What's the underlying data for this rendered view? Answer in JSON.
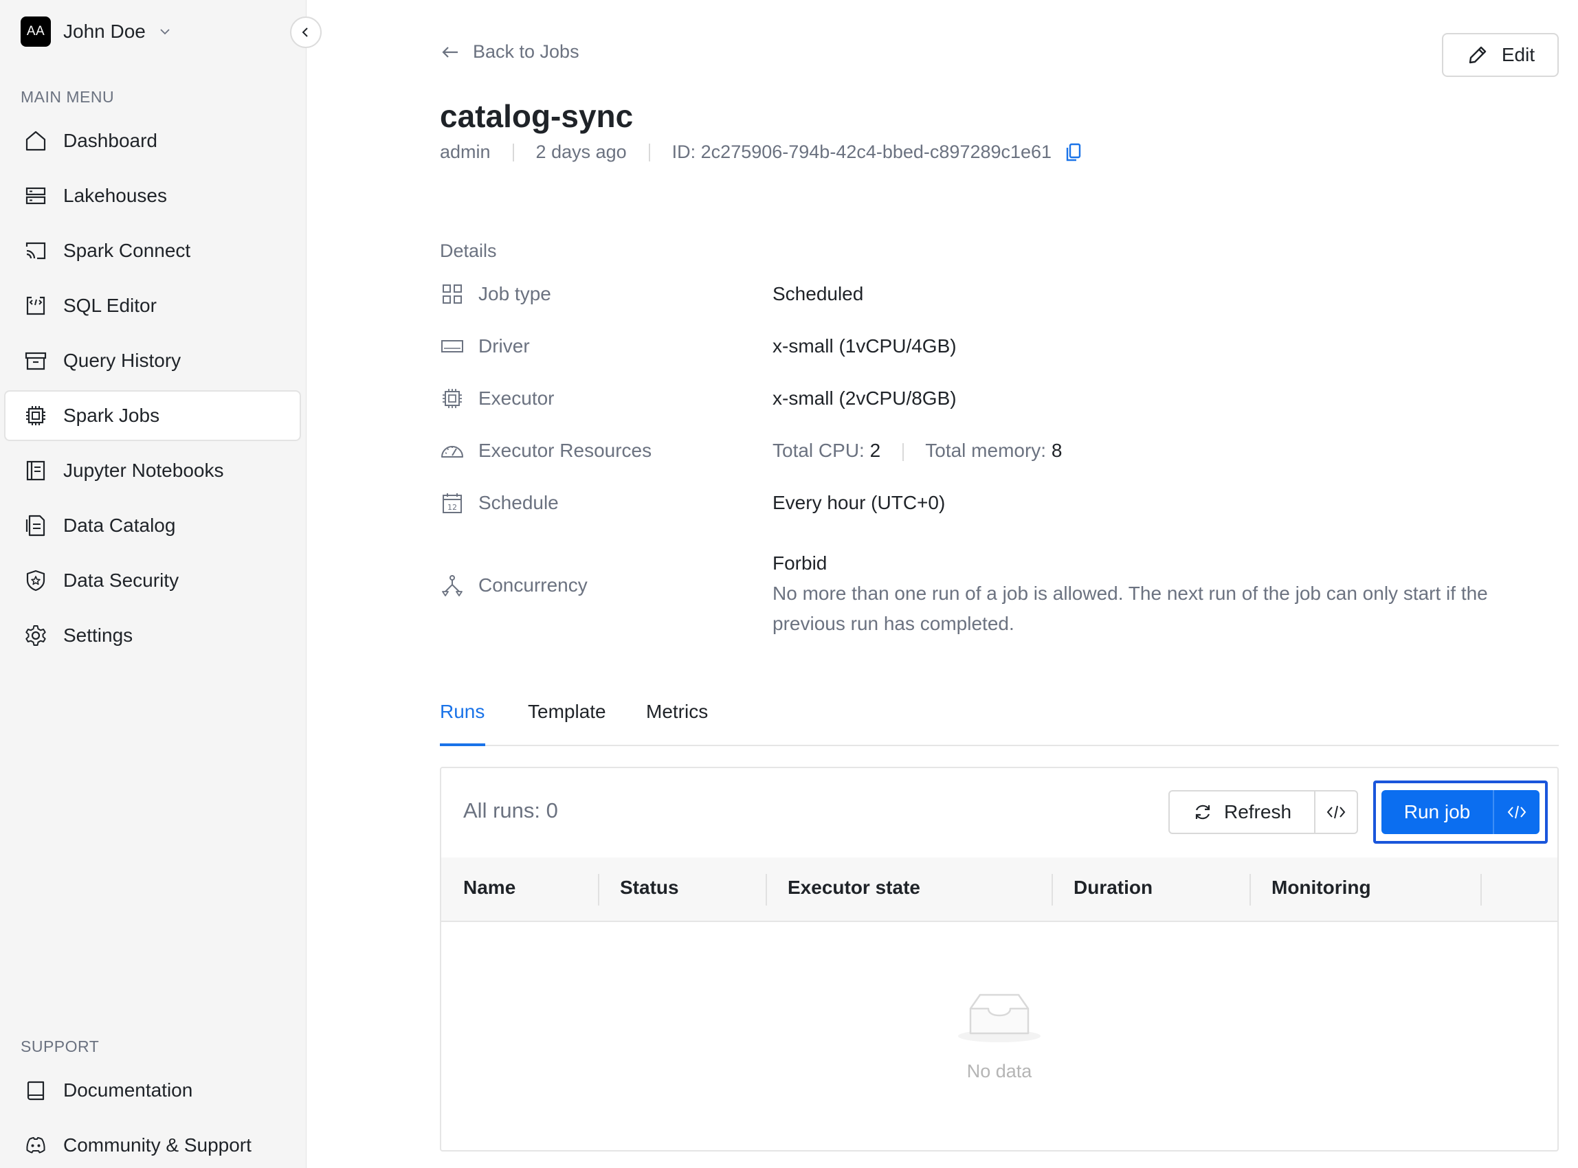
{
  "user": {
    "initials": "AA",
    "name": "John Doe"
  },
  "sidebar": {
    "main_menu_label": "MAIN MENU",
    "items": [
      {
        "label": "Dashboard",
        "icon": "home-icon"
      },
      {
        "label": "Lakehouses",
        "icon": "server-icon"
      },
      {
        "label": "Spark Connect",
        "icon": "cast-icon"
      },
      {
        "label": "SQL Editor",
        "icon": "sql-editor-icon"
      },
      {
        "label": "Query History",
        "icon": "archive-icon"
      },
      {
        "label": "Spark Jobs",
        "icon": "cpu-icon",
        "active": true
      },
      {
        "label": "Jupyter Notebooks",
        "icon": "notebook-icon"
      },
      {
        "label": "Data Catalog",
        "icon": "catalog-icon"
      },
      {
        "label": "Data Security",
        "icon": "shield-icon"
      },
      {
        "label": "Settings",
        "icon": "gear-icon"
      }
    ],
    "support_label": "SUPPORT",
    "support_items": [
      {
        "label": "Documentation",
        "icon": "book-icon"
      },
      {
        "label": "Community & Support",
        "icon": "discord-icon"
      }
    ]
  },
  "header": {
    "back_label": "Back to Jobs",
    "edit_label": "Edit",
    "title": "catalog-sync",
    "owner": "admin",
    "created": "2 days ago",
    "id_text": "ID: 2c275906-794b-42c4-bbed-c897289c1e61"
  },
  "details": {
    "label": "Details",
    "job_type_key": "Job type",
    "job_type_value": "Scheduled",
    "driver_key": "Driver",
    "driver_value": "x-small (1vCPU/4GB)",
    "executor_key": "Executor",
    "executor_value": "x-small (2vCPU/8GB)",
    "resources_key": "Executor Resources",
    "total_cpu_label": "Total CPU:",
    "total_cpu_value": "2",
    "total_memory_label": "Total memory:",
    "total_memory_value": "8",
    "schedule_key": "Schedule",
    "schedule_value": "Every hour (UTC+0)",
    "concurrency_key": "Concurrency",
    "concurrency_value": "Forbid",
    "concurrency_desc": "No more than one run of a job is allowed. The next run of the job can only start if the previous run has completed."
  },
  "tabs": [
    "Runs",
    "Template",
    "Metrics"
  ],
  "runs": {
    "all_runs_label": "All runs: 0",
    "refresh_label": "Refresh",
    "run_job_label": "Run job",
    "columns": [
      "Name",
      "Status",
      "Executor state",
      "Duration",
      "Monitoring"
    ],
    "empty_text": "No data"
  },
  "colors": {
    "primary": "#0b6ef0",
    "focus": "#1a56db",
    "tab_active": "#1a73e8",
    "copy_icon": "#1a73e8"
  }
}
